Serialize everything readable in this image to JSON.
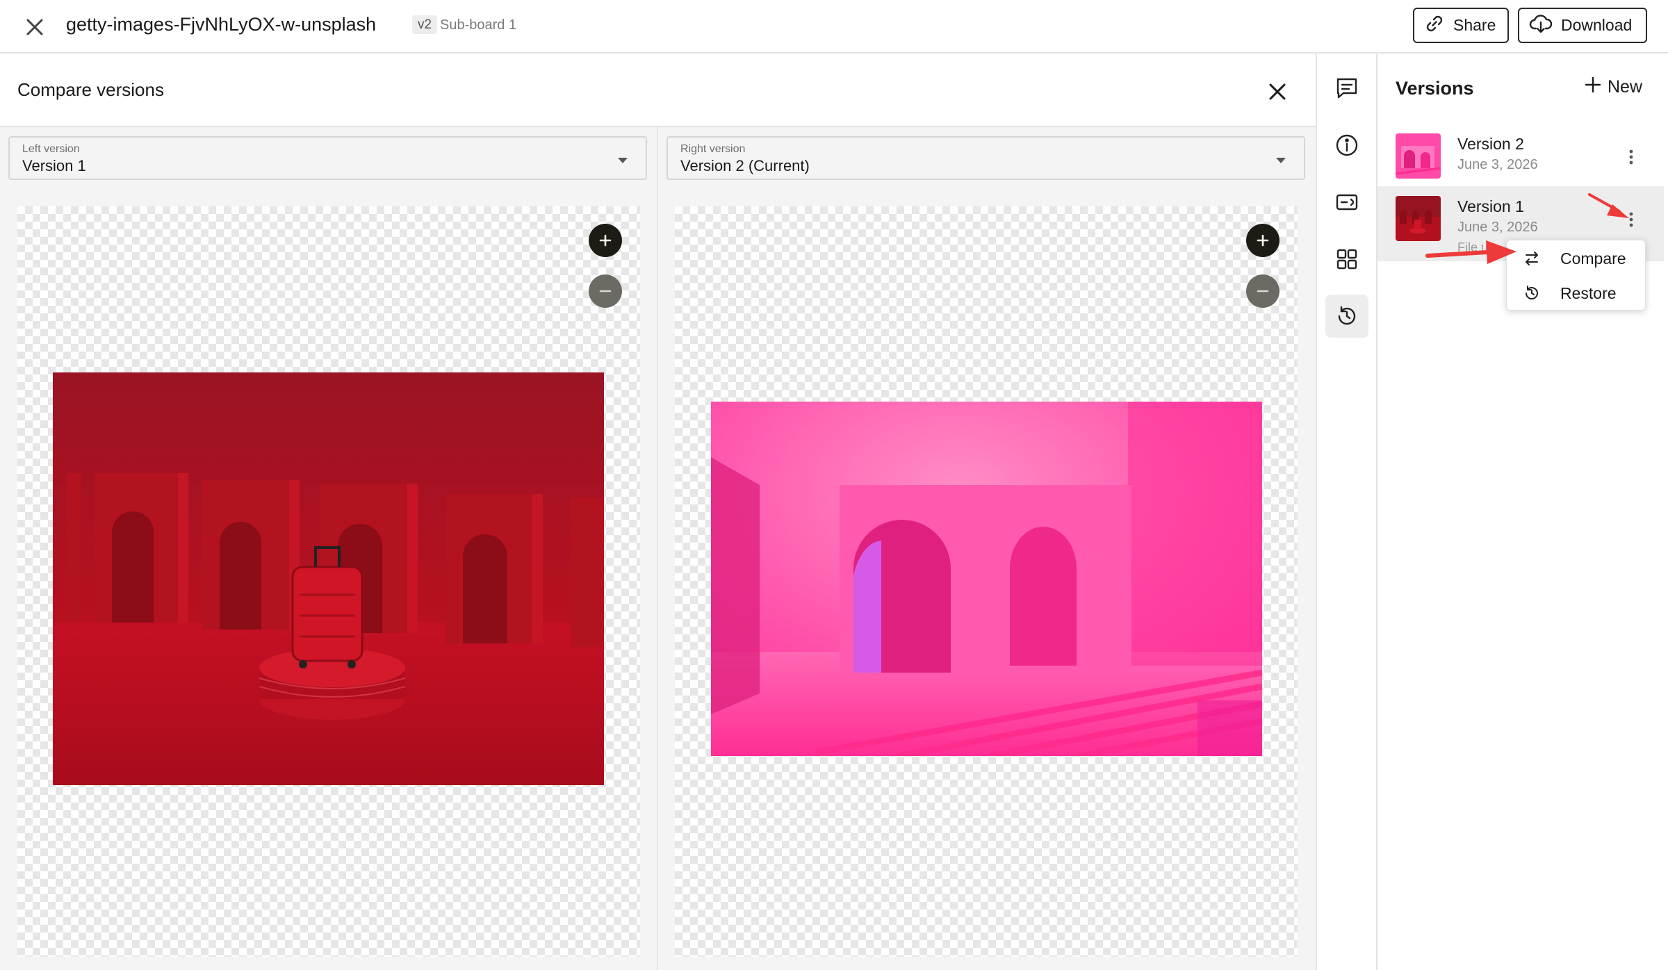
{
  "topbar": {
    "file_title": "getty-images-FjvNhLyOX-w-unsplash",
    "version_badge": "v2",
    "board_label": "Sub-board 1",
    "share_label": "Share",
    "download_label": "Download"
  },
  "compare": {
    "title": "Compare versions",
    "left_select": {
      "label": "Left version",
      "value": "Version 1"
    },
    "right_select": {
      "label": "Right version",
      "value": "Version 2 (Current)"
    }
  },
  "rail": {
    "icons": [
      "comment-icon",
      "info-icon",
      "toggle-icon",
      "grid-icon",
      "history-icon"
    ],
    "active": "history-icon"
  },
  "versions": {
    "title": "Versions",
    "new_label": "New",
    "items": [
      {
        "name": "Version 2",
        "date": "June 3, 2026",
        "extra": ""
      },
      {
        "name": "Version 1",
        "date": "June 3, 2026",
        "extra": "File u"
      }
    ]
  },
  "context_menu": {
    "items": [
      {
        "label": "Compare",
        "icon": "swap-arrows-icon"
      },
      {
        "label": "Restore",
        "icon": "restore-icon"
      }
    ]
  },
  "colors": {
    "left_image_base": "#b3101f",
    "right_image_base": "#ff2f9a",
    "annotation_arrow": "#ee3a3a"
  }
}
